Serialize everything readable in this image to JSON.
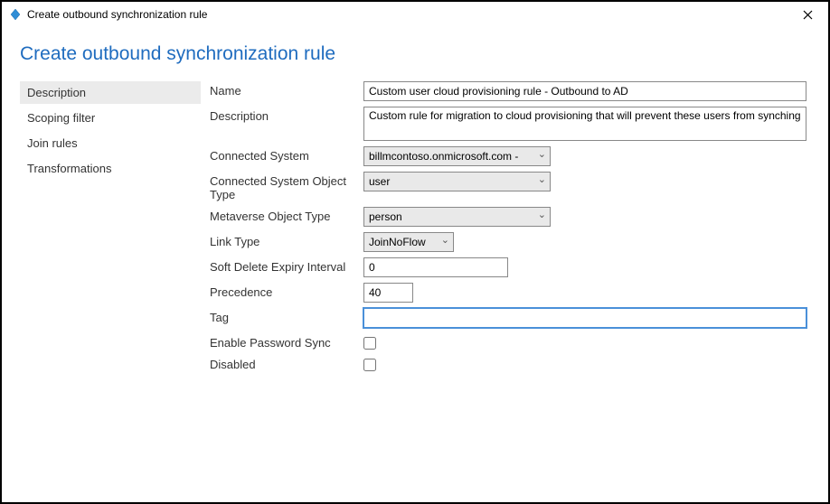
{
  "window": {
    "title": "Create outbound synchronization rule"
  },
  "header": {
    "page_title": "Create outbound synchronization rule"
  },
  "sidebar": {
    "items": [
      {
        "label": "Description"
      },
      {
        "label": "Scoping filter"
      },
      {
        "label": "Join rules"
      },
      {
        "label": "Transformations"
      }
    ]
  },
  "form": {
    "name_label": "Name",
    "name_value": "Custom user cloud provisioning rule - Outbound to AD",
    "description_label": "Description",
    "description_value": "Custom rule for migration to cloud provisioning that will prevent these users from synching",
    "connected_system_label": "Connected System",
    "connected_system_value": "billmcontoso.onmicrosoft.com - ",
    "cs_object_type_label": "Connected System Object Type",
    "cs_object_type_value": "user",
    "mv_object_type_label": "Metaverse Object Type",
    "mv_object_type_value": "person",
    "link_type_label": "Link Type",
    "link_type_value": "JoinNoFlow",
    "soft_delete_label": "Soft Delete Expiry Interval",
    "soft_delete_value": "0",
    "precedence_label": "Precedence",
    "precedence_value": "40",
    "tag_label": "Tag",
    "tag_value": "",
    "password_sync_label": "Enable Password Sync",
    "disabled_label": "Disabled"
  }
}
